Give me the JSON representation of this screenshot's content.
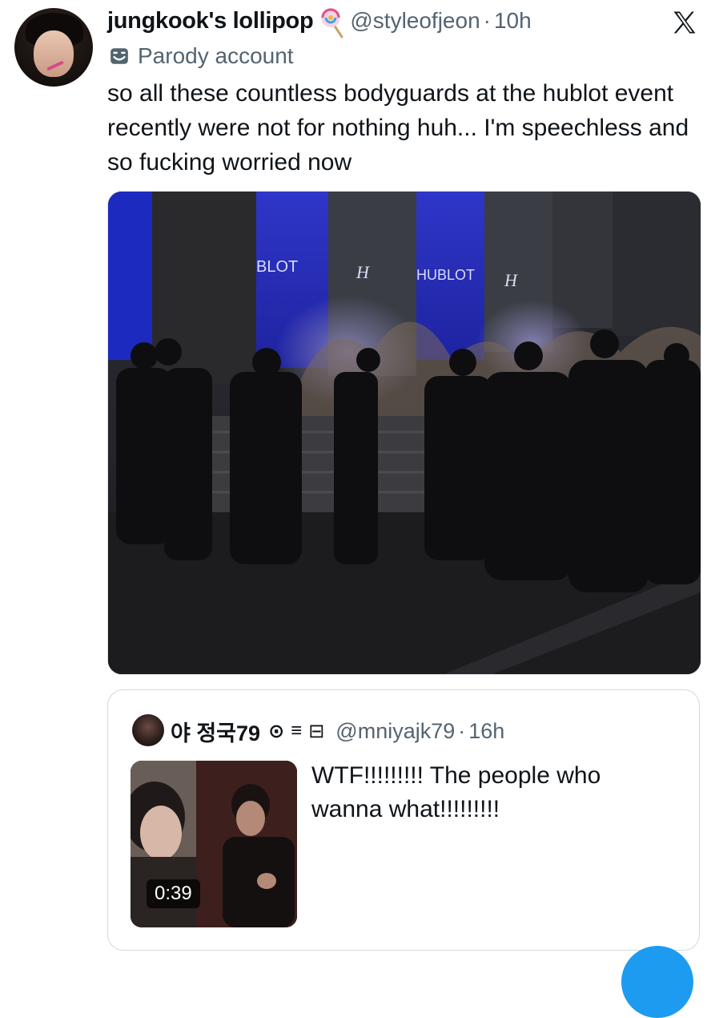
{
  "tweet": {
    "author": {
      "display_name": "jungkook's lollipop",
      "handle": "@styleofjeon",
      "separator": "·",
      "time": "10h",
      "label": "Parody account"
    },
    "text": "so all these countless bodyguards at the hublot event recently were not for nothing huh... I'm speechless and so fucking worried now",
    "media": {
      "signage": [
        "BLOT",
        "HUBLOT"
      ]
    }
  },
  "quoted_tweet": {
    "display_name": "야 정국79",
    "badges": [
      "⊙",
      "≡",
      "⊟"
    ],
    "handle": "@mniyajk79",
    "separator": "·",
    "time": "16h",
    "text": "WTF!!!!!!!!! The people who wanna what!!!!!!!!!",
    "video_duration": "0:39"
  },
  "icons": {
    "x_logo": "x-logo-icon",
    "parody": "parody-mask-icon",
    "lollipop": "lollipop-emoji-icon"
  },
  "colors": {
    "text": "#0f1419",
    "secondary": "#536471",
    "border": "#cfd9de",
    "accent": "#1d9bf0"
  }
}
